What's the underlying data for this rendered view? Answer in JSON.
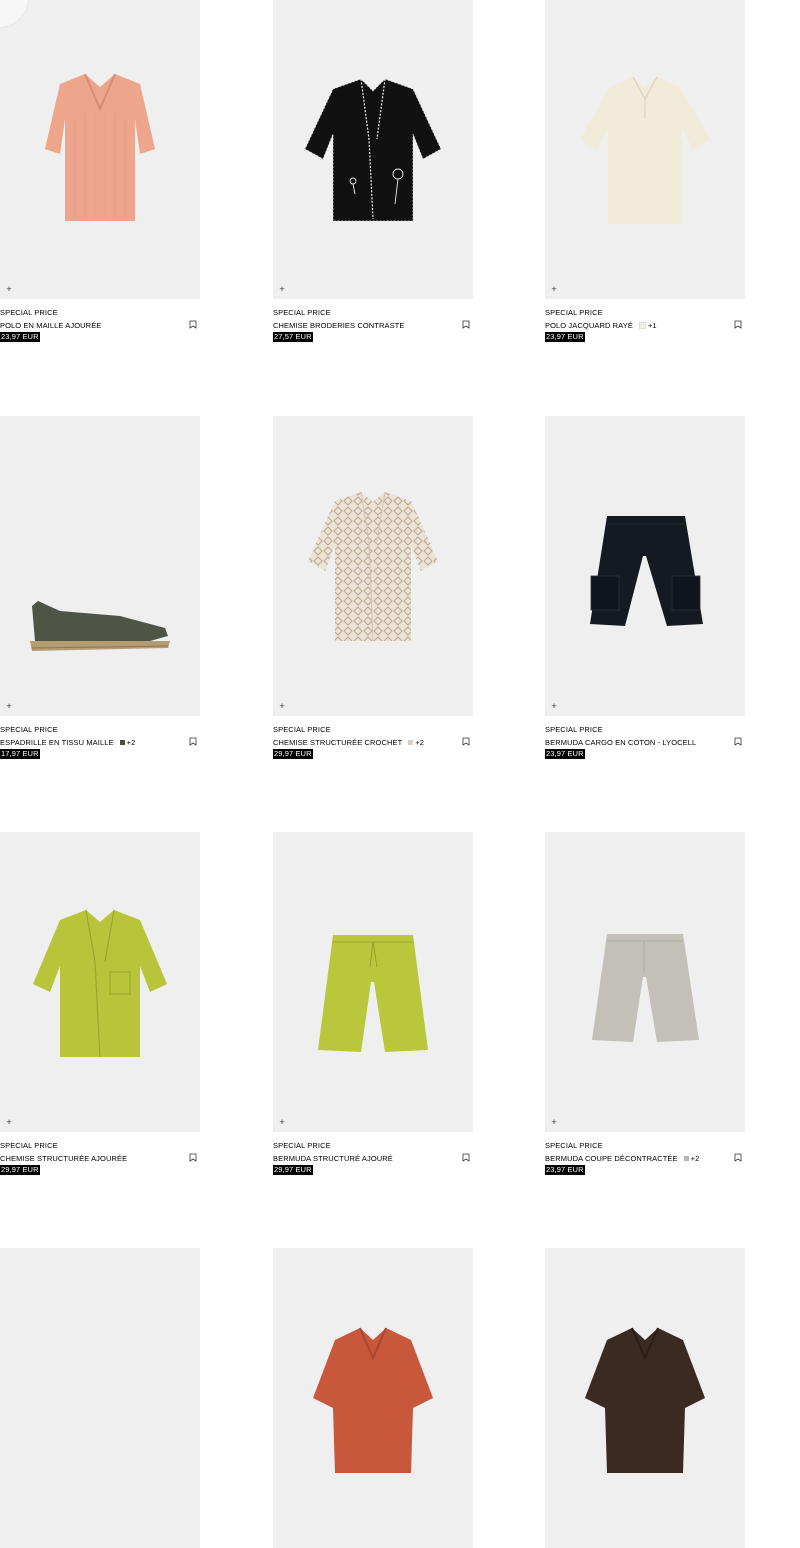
{
  "products": [
    {
      "tag": "SPECIAL PRICE",
      "name": "POLO EN MAILLE AJOURÉE",
      "price": "23,97 EUR",
      "swatch": null,
      "more": null,
      "icon": "polo-salmon"
    },
    {
      "tag": "SPECIAL PRICE",
      "name": "CHEMISE BRODERIES CONTRASTE",
      "price": "27,57 EUR",
      "swatch": null,
      "more": null,
      "icon": "shirt-black-embroidered"
    },
    {
      "tag": "SPECIAL PRICE",
      "name": "POLO JACQUARD RAYÉ",
      "price": "23,97 EUR",
      "swatch": "#f0eee0",
      "more": "+1",
      "icon": "polo-cream"
    },
    {
      "tag": "SPECIAL PRICE",
      "name": "ESPADRILLE EN TISSU MAILLE",
      "price": "17,97 EUR",
      "swatch": "#4a5141",
      "more": "+2",
      "icon": "espadrille-olive"
    },
    {
      "tag": "SPECIAL PRICE",
      "name": "CHEMISE STRUCTURÉE CROCHET",
      "price": "29,97 EUR",
      "swatch": "#d8cfc0",
      "more": "+2",
      "icon": "shirt-beige-crochet"
    },
    {
      "tag": "SPECIAL PRICE",
      "name": "BERMUDA CARGO EN COTON - LYOCELL",
      "price": "23,97 EUR",
      "swatch": null,
      "more": null,
      "icon": "bermuda-cargo-black"
    },
    {
      "tag": "SPECIAL PRICE",
      "name": "CHEMISE STRUCTURÉE AJOURÉE",
      "price": "29,97 EUR",
      "swatch": null,
      "more": null,
      "icon": "shirt-lime"
    },
    {
      "tag": "SPECIAL PRICE",
      "name": "BERMUDA STRUCTURÉ AJOURÉ",
      "price": "29,97 EUR",
      "swatch": null,
      "more": null,
      "icon": "shorts-lime"
    },
    {
      "tag": "SPECIAL PRICE",
      "name": "BERMUDA COUPE DÉCONTRACTÉE",
      "price": "23,97 EUR",
      "swatch": "#b8b7b1",
      "more": "+2",
      "icon": "bermuda-grey"
    },
    {
      "tag": "",
      "name": "",
      "price": "",
      "swatch": null,
      "more": null,
      "icon": "empty"
    },
    {
      "tag": "",
      "name": "",
      "price": "",
      "swatch": null,
      "more": null,
      "icon": "polo-rust"
    },
    {
      "tag": "",
      "name": "",
      "price": "",
      "swatch": null,
      "more": null,
      "icon": "polo-dark-brown"
    }
  ],
  "ui": {
    "add_glyph": "+",
    "bookmark_icon": "bookmark-icon",
    "add_icon": "plus-icon"
  }
}
